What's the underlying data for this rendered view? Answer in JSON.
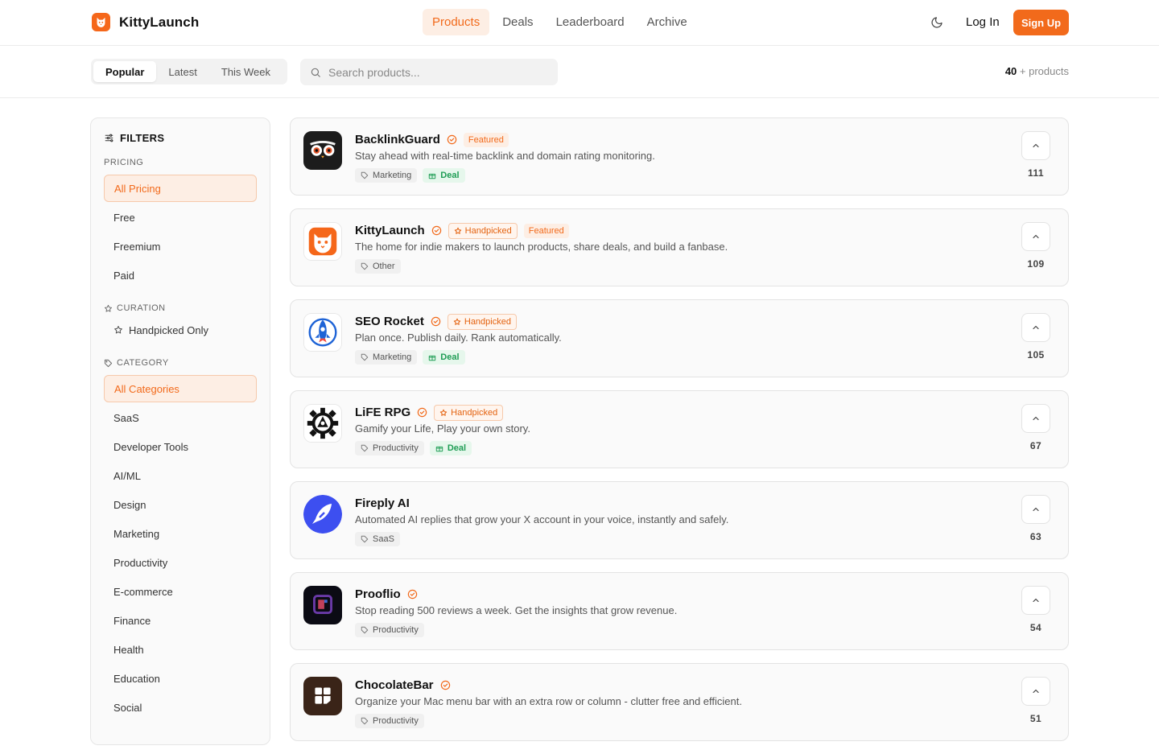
{
  "brand": {
    "name": "KittyLaunch"
  },
  "nav": {
    "links": [
      {
        "label": "Products",
        "active": true
      },
      {
        "label": "Deals",
        "active": false
      },
      {
        "label": "Leaderboard",
        "active": false
      },
      {
        "label": "Archive",
        "active": false
      }
    ],
    "login": "Log In",
    "signup": "Sign Up"
  },
  "toolbar": {
    "tabs": [
      {
        "label": "Popular",
        "active": true
      },
      {
        "label": "Latest",
        "active": false
      },
      {
        "label": "This Week",
        "active": false
      }
    ],
    "search_placeholder": "Search products...",
    "count_number": "40",
    "count_suffix": "+ products"
  },
  "filters": {
    "title": "FILTERS",
    "pricing_title": "PRICING",
    "pricing": [
      {
        "label": "All Pricing",
        "active": true
      },
      {
        "label": "Free",
        "active": false
      },
      {
        "label": "Freemium",
        "active": false
      },
      {
        "label": "Paid",
        "active": false
      }
    ],
    "curation_title": "CURATION",
    "curation_item": "Handpicked Only",
    "category_title": "CATEGORY",
    "categories": [
      {
        "label": "All Categories",
        "active": true
      },
      {
        "label": "SaaS",
        "active": false
      },
      {
        "label": "Developer Tools",
        "active": false
      },
      {
        "label": "AI/ML",
        "active": false
      },
      {
        "label": "Design",
        "active": false
      },
      {
        "label": "Marketing",
        "active": false
      },
      {
        "label": "Productivity",
        "active": false
      },
      {
        "label": "E-commerce",
        "active": false
      },
      {
        "label": "Finance",
        "active": false
      },
      {
        "label": "Health",
        "active": false
      },
      {
        "label": "Education",
        "active": false
      },
      {
        "label": "Social",
        "active": false
      }
    ]
  },
  "labels": {
    "featured": "Featured",
    "handpicked": "Handpicked",
    "deal": "Deal"
  },
  "products": [
    {
      "name": "BacklinkGuard",
      "verified": true,
      "handpicked": false,
      "featured": true,
      "description": "Stay ahead with real-time backlink and domain rating monitoring.",
      "tag": "Marketing",
      "deal": true,
      "votes": "111",
      "logo": "owl-logo"
    },
    {
      "name": "KittyLaunch",
      "verified": true,
      "handpicked": true,
      "featured": true,
      "description": "The home for indie makers to launch products, share deals, and build a fanbase.",
      "tag": "Other",
      "deal": false,
      "votes": "109",
      "logo": "cat-logo"
    },
    {
      "name": "SEO Rocket",
      "verified": true,
      "handpicked": true,
      "featured": false,
      "description": "Plan once. Publish daily. Rank automatically.",
      "tag": "Marketing",
      "deal": true,
      "votes": "105",
      "logo": "rocket-logo"
    },
    {
      "name": "LiFE RPG",
      "verified": true,
      "handpicked": true,
      "featured": false,
      "description": "Gamify your Life, Play your own story.",
      "tag": "Productivity",
      "deal": true,
      "votes": "67",
      "logo": "gear-logo"
    },
    {
      "name": "Fireply AI",
      "verified": false,
      "handpicked": false,
      "featured": false,
      "description": "Automated AI replies that grow your X account in your voice, instantly and safely.",
      "tag": "SaaS",
      "deal": false,
      "votes": "63",
      "logo": "fireply-logo"
    },
    {
      "name": "Prooflio",
      "verified": true,
      "handpicked": false,
      "featured": false,
      "description": "Stop reading 500 reviews a week. Get the insights that grow revenue.",
      "tag": "Productivity",
      "deal": false,
      "votes": "54",
      "logo": "prooflio-logo"
    },
    {
      "name": "ChocolateBar",
      "verified": true,
      "handpicked": false,
      "featured": false,
      "description": "Organize your Mac menu bar with an extra row or column - clutter free and efficient.",
      "tag": "Productivity",
      "deal": false,
      "votes": "51",
      "logo": "chocolatebar-logo"
    }
  ],
  "colors": {
    "accent": "#f26a1b",
    "deal": "#1f9d55"
  }
}
